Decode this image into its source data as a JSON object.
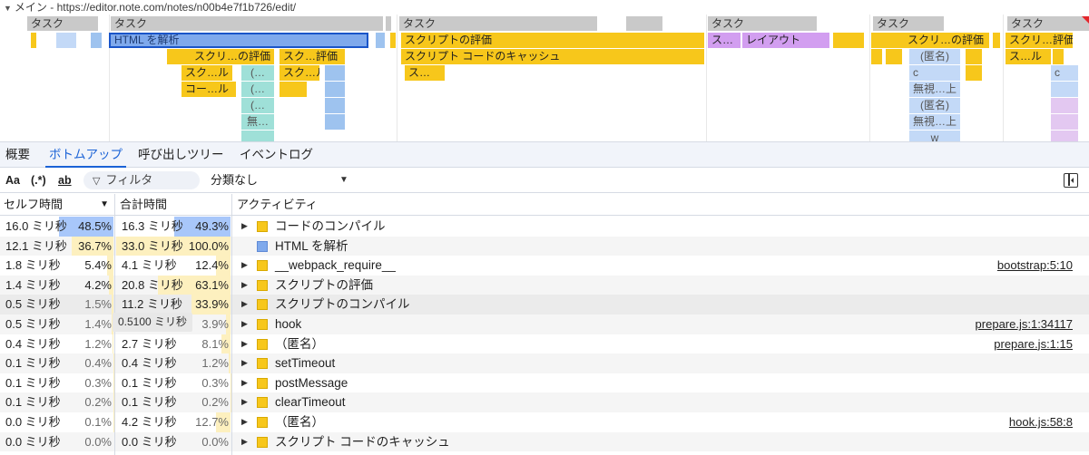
{
  "flame": {
    "track_title": "メイン - https://editor.note.com/notes/n00b4e7f1b726/edit/",
    "tasks": [
      "タスク",
      "タスク",
      "タスク",
      "タスク",
      "タスク",
      "タスク"
    ],
    "events": {
      "parse_html": "HTML を解析",
      "eval_script_1": "スクリプトの評価",
      "eval_script_2": "スクリ…の評価",
      "eval_script_3": "スク…評価",
      "eval_script_4": "スクリ…の評価",
      "eval_script_5": "スクリ…評価",
      "script_cache": "スクリプト コードのキャッシュ",
      "s1": "ス…",
      "s2": "ス…",
      "layout": "レイアウト",
      "sk1": "スク…ル",
      "sk2": "スク…ル",
      "sk3": "ス…ル",
      "co1": "コー…ル",
      "par1": "(…",
      "par2": "(…",
      "par3": "(…",
      "nashi": "無…",
      "anon1": "(匿名)",
      "anon2": "(匿名)",
      "c1": "c",
      "c2": "c",
      "mushi1": "無視…上",
      "mushi2": "無視…上",
      "w": "w"
    }
  },
  "tabs": [
    {
      "label": "概要"
    },
    {
      "label": "ボトムアップ"
    },
    {
      "label": "呼び出しツリー"
    },
    {
      "label": "イベントログ"
    }
  ],
  "toolbar": {
    "match_case": "Aa",
    "regex": "(.*)",
    "whole_word": "ab",
    "filter_placeholder": "フィルタ",
    "grouping": "分類なし"
  },
  "table": {
    "headers": {
      "self": "セルフ時間",
      "total": "合計時間",
      "activity": "アクティビティ"
    },
    "tooltip": "0.5100 ミリ秒",
    "rows": [
      {
        "self": "16.0 ミリ秒",
        "self_pct": "48.5%",
        "self_frac": 0.485,
        "total": "16.3 ミリ秒",
        "total_pct": "49.3%",
        "total_frac": 0.493,
        "activity": "コードのコンパイル",
        "link": "",
        "expand": true,
        "color": "yellow"
      },
      {
        "self": "12.1 ミリ秒",
        "self_pct": "36.7%",
        "self_frac": 0.367,
        "total": "33.0 ミリ秒",
        "total_pct": "100.0%",
        "total_frac": 1.0,
        "activity": "HTML を解析",
        "link": "",
        "expand": false,
        "color": "blue"
      },
      {
        "self": "1.8 ミリ秒",
        "self_pct": "5.4%",
        "self_frac": 0.054,
        "total": "4.1 ミリ秒",
        "total_pct": "12.4%",
        "total_frac": 0.124,
        "activity": "__webpack_require__",
        "link": "bootstrap:5:10",
        "expand": true,
        "color": "yellow"
      },
      {
        "self": "1.4 ミリ秒",
        "self_pct": "4.2%",
        "self_frac": 0.042,
        "total": "20.8 ミリ秒",
        "total_pct": "63.1%",
        "total_frac": 0.631,
        "activity": "スクリプトの評価",
        "link": "",
        "expand": true,
        "color": "yellow"
      },
      {
        "self": "0.5 ミリ秒",
        "self_pct": "1.5%",
        "self_frac": 0.015,
        "total": "11.2 ミリ秒",
        "total_pct": "33.9%",
        "total_frac": 0.339,
        "activity": "スクリプトのコンパイル",
        "link": "",
        "expand": true,
        "color": "yellow"
      },
      {
        "self": "0.5 ミリ秒",
        "self_pct": "1.4%",
        "self_frac": 0.014,
        "total": "",
        "total_pct": "3.9%",
        "total_frac": 0.039,
        "activity": "hook",
        "link": "prepare.js:1:34117",
        "expand": true,
        "color": "yellow"
      },
      {
        "self": "0.4 ミリ秒",
        "self_pct": "1.2%",
        "self_frac": 0.012,
        "total": "2.7 ミリ秒",
        "total_pct": "8.1%",
        "total_frac": 0.081,
        "activity": "（匿名）",
        "link": "prepare.js:1:15",
        "expand": true,
        "color": "yellow"
      },
      {
        "self": "0.1 ミリ秒",
        "self_pct": "0.4%",
        "self_frac": 0.004,
        "total": "0.4 ミリ秒",
        "total_pct": "1.2%",
        "total_frac": 0.012,
        "activity": "setTimeout",
        "link": "",
        "expand": true,
        "color": "yellow"
      },
      {
        "self": "0.1 ミリ秒",
        "self_pct": "0.3%",
        "self_frac": 0.003,
        "total": "0.1 ミリ秒",
        "total_pct": "0.3%",
        "total_frac": 0.003,
        "activity": "postMessage",
        "link": "",
        "expand": true,
        "color": "yellow"
      },
      {
        "self": "0.1 ミリ秒",
        "self_pct": "0.2%",
        "self_frac": 0.002,
        "total": "0.1 ミリ秒",
        "total_pct": "0.2%",
        "total_frac": 0.002,
        "activity": "clearTimeout",
        "link": "",
        "expand": true,
        "color": "yellow"
      },
      {
        "self": "0.0 ミリ秒",
        "self_pct": "0.1%",
        "self_frac": 0.001,
        "total": "4.2 ミリ秒",
        "total_pct": "12.7%",
        "total_frac": 0.127,
        "activity": "（匿名）",
        "link": "hook.js:58:8",
        "expand": true,
        "color": "yellow"
      },
      {
        "self": "0.0 ミリ秒",
        "self_pct": "0.0%",
        "self_frac": 0.0,
        "total": "0.0 ミリ秒",
        "total_pct": "0.0%",
        "total_frac": 0.0,
        "activity": "スクリプト コードのキャッシュ",
        "link": "",
        "expand": true,
        "color": "yellow"
      }
    ]
  },
  "colors": {
    "accent": "#1a62d6",
    "script": "#f7c71b",
    "parse": "#7fa9ec",
    "layout": "#d29ef0"
  }
}
